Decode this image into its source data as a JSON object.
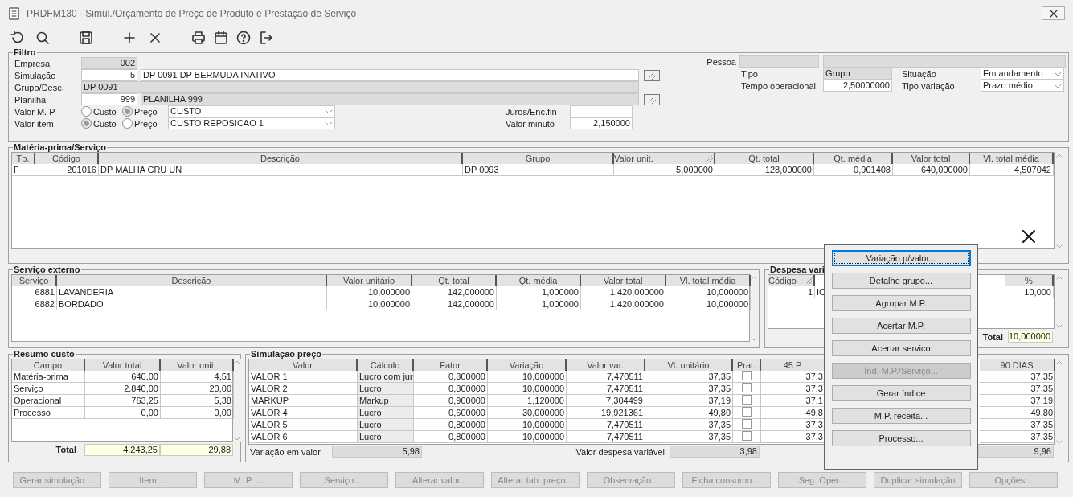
{
  "window": {
    "title": "PRDFM130 - Simul./Orçamento de Preço de Produto e Prestação de Serviço"
  },
  "filtro": {
    "title": "Filtro",
    "empresa": {
      "label": "Empresa",
      "value": "002"
    },
    "simulacao": {
      "label": "Simulação",
      "code": "5",
      "description": "DP 0091 DP BERMUDA INATIVO"
    },
    "grupo": {
      "label": "Grupo/Desc.",
      "value": "DP 0091"
    },
    "planilha": {
      "label": "Planilha",
      "code": "999",
      "description": "PLANILHA 999"
    },
    "valor_mp": {
      "label": "Valor M. P.",
      "options": [
        {
          "label": "Custo",
          "selected": false
        },
        {
          "label": "Preço",
          "selected": true
        }
      ],
      "select": "CUSTO"
    },
    "valor_item": {
      "label": "Valor item",
      "options": [
        {
          "label": "Custo",
          "selected": true
        },
        {
          "label": "Preço",
          "selected": false
        }
      ],
      "select": "CUSTO REPOSICAO 1"
    },
    "juros": {
      "label": "Juros/Enc.fin"
    },
    "valor_minuto": {
      "label": "Valor minuto",
      "value": "2,150000"
    },
    "pessoa": {
      "label": "Pessoa"
    },
    "tipo": {
      "label": "Tipo",
      "value": "Grupo"
    },
    "tempo_operacional": {
      "label": "Tempo operacional",
      "value": "2,50000000"
    },
    "situacao": {
      "label": "Situação",
      "value": "Em andamento"
    },
    "tipo_variacao": {
      "label": "Tipo variação",
      "value": "Prazo médio"
    }
  },
  "materia_prima": {
    "title": "Matéria-prima/Serviço",
    "columns": [
      {
        "label": "Tp.",
        "sort_icon": false
      },
      {
        "label": "Código",
        "sort_icon": false
      },
      {
        "label": "Descrição",
        "sort_icon": false
      },
      {
        "label": "Grupo",
        "sort_icon": false
      },
      {
        "label": "Valor unit.",
        "sort_icon": true
      },
      {
        "label": "Qt. total",
        "sort_icon": false
      },
      {
        "label": "Qt. média",
        "sort_icon": false
      },
      {
        "label": "Valor total",
        "sort_icon": false
      },
      {
        "label": "Vl. total média",
        "sort_icon": false
      }
    ],
    "rows": [
      [
        "F",
        "201016",
        "DP MALHA CRU UN",
        "DP 0093",
        "5,000000",
        "128,000000",
        "0,901408",
        "640,000000",
        "4,507042"
      ]
    ]
  },
  "servico_externo": {
    "title": "Serviço externo",
    "columns": [
      "Serviço",
      "Descrição",
      "Valor unitário",
      "Qt. total",
      "Qt. média",
      "Valor total",
      "Vl. total média"
    ],
    "rows": [
      [
        "6881",
        "LAVANDERIA",
        "10,000000",
        "142,000000",
        "1,000000",
        "1.420,000000",
        "10,000000"
      ],
      [
        "6882",
        "BORDADO",
        "10,000000",
        "142,000000",
        "1,000000",
        "1.420,000000",
        "10,000000"
      ]
    ]
  },
  "despesa": {
    "title": "Despesa vari",
    "columns": [
      {
        "label": "Código",
        "sort_icon": true
      },
      {
        "label": "%",
        "sort_icon": false
      }
    ],
    "rows": [
      {
        "codigo": "1",
        "column_3": "IC",
        "pct": "10,000"
      }
    ],
    "total": {
      "label": "Total",
      "value": "10,000000"
    }
  },
  "resumo_custo": {
    "title": "Resumo custo",
    "columns": [
      "Campo",
      "Valor total",
      "Valor unit."
    ],
    "rows": [
      [
        "Matéria-prima",
        "640,00",
        "4,51"
      ],
      [
        "Serviço",
        "2.840,00",
        "20,00"
      ],
      [
        "Operacional",
        "763,25",
        "5,38"
      ],
      [
        "Processo",
        "0,00",
        "0,00"
      ]
    ],
    "total": {
      "label": "Total",
      "valor_total": "4.243,25",
      "valor_unit": "29,88"
    }
  },
  "simulacao_preco": {
    "title": "Simulação preço",
    "columns": [
      "Valor",
      "Cálculo",
      "Fator",
      "Variação",
      "Valor var.",
      "Vl. unitário",
      "Prat.",
      "45 P",
      "90 DIAS"
    ],
    "rows": [
      {
        "valor": "VALOR 1",
        "calculo": "Lucro com jur",
        "fator": "0,800000",
        "variacao": "10,000000",
        "valor_var": "7,470511",
        "vl_unitario": "37,35",
        "prat": false,
        "p45": "37,3",
        "d90": "37,35"
      },
      {
        "valor": "VALOR 2",
        "calculo": "Lucro",
        "fator": "0,800000",
        "variacao": "10,000000",
        "valor_var": "7,470511",
        "vl_unitario": "37,35",
        "prat": false,
        "p45": "37,3",
        "d90": "37,35"
      },
      {
        "valor": "MARKUP",
        "calculo": "Markup",
        "fator": "0,900000",
        "variacao": "1,120000",
        "valor_var": "7,304499",
        "vl_unitario": "37,19",
        "prat": false,
        "p45": "37,1",
        "d90": "37,19"
      },
      {
        "valor": "VALOR 4",
        "calculo": "Lucro",
        "fator": "0,600000",
        "variacao": "30,000000",
        "valor_var": "19,921361",
        "vl_unitario": "49,80",
        "prat": false,
        "p45": "49,8",
        "d90": "49,80"
      },
      {
        "valor": "VALOR 5",
        "calculo": "Lucro",
        "fator": "0,800000",
        "variacao": "10,000000",
        "valor_var": "7,470511",
        "vl_unitario": "37,35",
        "prat": false,
        "p45": "37,3",
        "d90": "37,35"
      },
      {
        "valor": "VALOR 6",
        "calculo": "Lucro",
        "fator": "0,800000",
        "variacao": "10,000000",
        "valor_var": "7,470511",
        "vl_unitario": "37,35",
        "prat": false,
        "p45": "37,3",
        "d90": "37,35"
      }
    ],
    "variacao_valor": {
      "label": "Variação em valor",
      "value": "5,98"
    },
    "despesa_variavel": {
      "label": "Valor despesa variável",
      "value": "3,98"
    },
    "total_90": "9,96"
  },
  "buttons": [
    {
      "label": "Gerar simulação ...",
      "disabled": true
    },
    {
      "label": "Item ...",
      "disabled": true
    },
    {
      "label": "M. P. ...",
      "disabled": true
    },
    {
      "label": "Serviço ...",
      "disabled": true
    },
    {
      "label": "Alterar valor...",
      "disabled": true
    },
    {
      "label": "Alterar tab. preço...",
      "disabled": true
    },
    {
      "label": "Observação...",
      "disabled": true
    },
    {
      "label": "Ficha consumo ...",
      "disabled": true
    },
    {
      "label": "Seg. Oper...",
      "disabled": true
    },
    {
      "label": "Duplicar simulação",
      "disabled": true
    },
    {
      "label": "Opções...",
      "disabled": true
    }
  ],
  "popup_menu": [
    {
      "label": "Variação p/valor...",
      "disabled": false,
      "focused": true
    },
    {
      "label": "Detalhe grupo...",
      "disabled": false,
      "focused": false
    },
    {
      "label": "Agrupar M.P.",
      "disabled": false,
      "focused": false
    },
    {
      "label": "Acertar M.P.",
      "disabled": false,
      "focused": false
    },
    {
      "label": "Acertar servico",
      "disabled": false,
      "focused": false
    },
    {
      "label": "Índ. M.P./Serviço...",
      "disabled": true,
      "focused": false
    },
    {
      "label": "Gerar índice",
      "disabled": false,
      "focused": false
    },
    {
      "label": "M.P. receita...",
      "disabled": false,
      "focused": false
    },
    {
      "label": "Processo...",
      "disabled": false,
      "focused": false
    }
  ]
}
